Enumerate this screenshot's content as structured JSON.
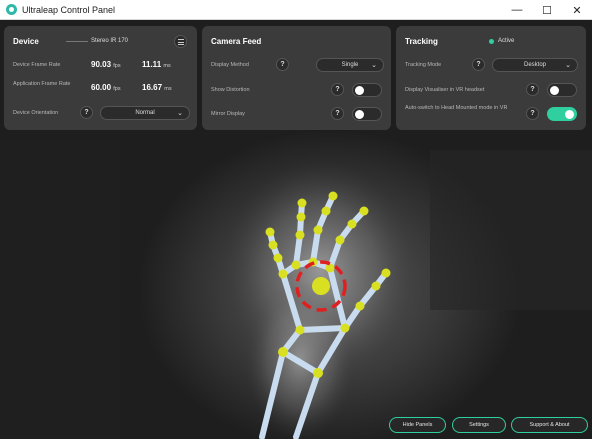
{
  "window": {
    "title": "Ultraleap Control Panel",
    "controls": {
      "minimize": "—",
      "maximize": "☐",
      "close": "✕"
    }
  },
  "device": {
    "title": "Device",
    "camera": "Stereo IR 170",
    "frame_rate_label": "Device Frame Rate",
    "frame_rate_fps": "90.03",
    "frame_rate_fps_unit": "fps",
    "frame_rate_ms": "11.11",
    "frame_rate_ms_unit": "ms",
    "app_rate_label": "Application Frame Rate",
    "app_rate_fps": "60.00",
    "app_rate_fps_unit": "fps",
    "app_rate_ms": "16.67",
    "app_rate_ms_unit": "ms",
    "orientation_label": "Device Orientation",
    "orientation_value": "Normal"
  },
  "camera_feed": {
    "title": "Camera Feed",
    "display_method_label": "Display Method",
    "display_method_value": "Single",
    "show_distortion_label": "Show Distortion",
    "show_distortion_on": false,
    "mirror_display_label": "Mirror Display",
    "mirror_display_on": false
  },
  "tracking": {
    "title": "Tracking",
    "status": "Active",
    "status_color": "#2fcf9f",
    "mode_label": "Tracking Mode",
    "mode_value": "Desktop",
    "visualiser_label": "Display Visualiser in VR headset",
    "visualiser_on": false,
    "auto_switch_label": "Auto-switch to Head Mounted mode in VR",
    "auto_switch_on": true
  },
  "common": {
    "help": "?",
    "chevron": "⌄"
  },
  "bottom": {
    "hide_panels": "Hide Panels",
    "settings": "Settings",
    "support": "Support & About"
  },
  "colors": {
    "accent": "#2fcf9f",
    "joint": "#d9e021",
    "highlight_ring": "#e02020"
  }
}
